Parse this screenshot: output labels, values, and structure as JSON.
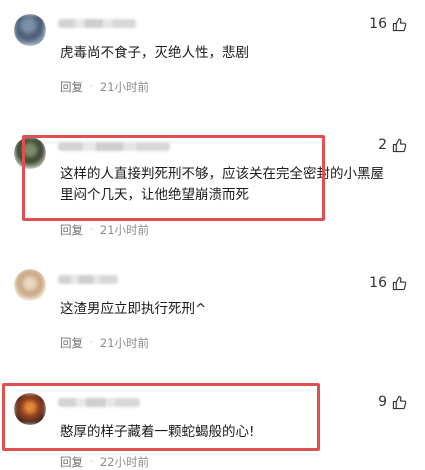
{
  "comments": [
    {
      "likes": "16",
      "text": "虎毒尚不食子，灭绝人性，悲剧",
      "reply_label": "回复",
      "time": "21小时前"
    },
    {
      "likes": "2",
      "text": "这样的人直接判死刑不够，应该关在完全密封的小黑屋里闷个几天，让他绝望崩溃而死",
      "reply_label": "回复",
      "time": "21小时前"
    },
    {
      "likes": "16",
      "text": "这渣男应立即执行死刑^",
      "reply_label": "回复",
      "time": "21小时前"
    },
    {
      "likes": "9",
      "text": "憨厚的样子藏着一颗蛇蝎般的心!",
      "reply_label": "回复",
      "time": "22小时前"
    }
  ],
  "meta_separator": "·",
  "colors": {
    "highlight": "#e05050",
    "meta_text": "#8c8c8c"
  },
  "icons": {
    "like": "thumbs-up-icon",
    "avatar": "blurred-avatar"
  }
}
